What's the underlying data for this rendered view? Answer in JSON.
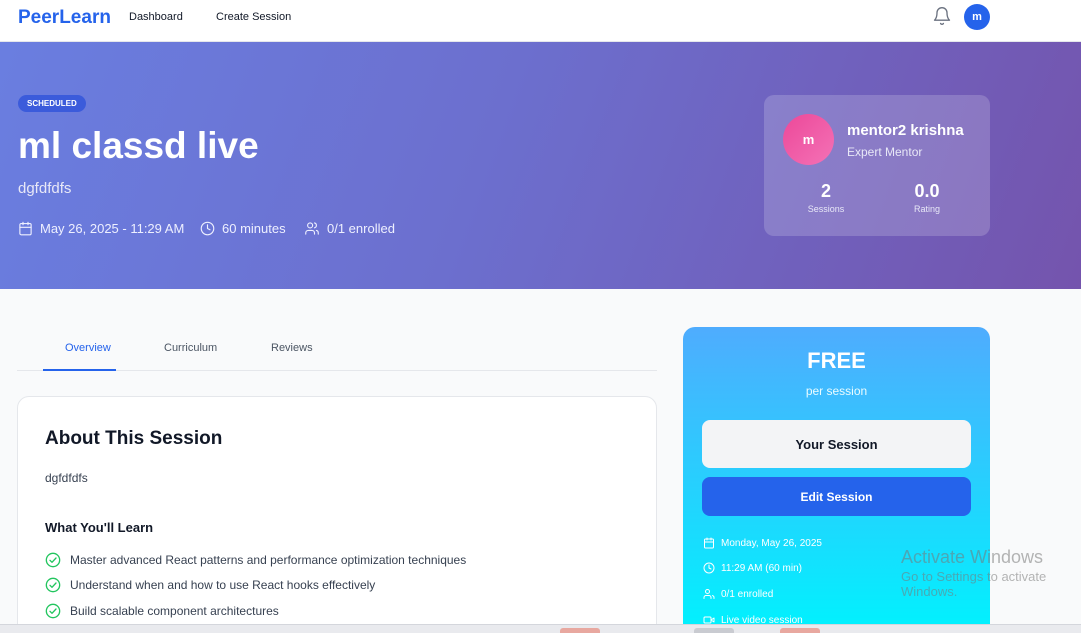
{
  "nav": {
    "brand": "PeerLearn",
    "links": [
      "Dashboard",
      "Create Session"
    ],
    "avatar_initial": "m"
  },
  "session": {
    "status_badge": "SCHEDULED",
    "title": "ml classd live",
    "subtitle": "dgfdfdfs",
    "date_time": "May 26, 2025 - 11:29 AM",
    "duration": "60 minutes",
    "enrolled": "0/1 enrolled"
  },
  "mentor": {
    "avatar_initial": "m",
    "name": "mentor2 krishna",
    "role": "Expert Mentor",
    "stats": [
      {
        "value": "2",
        "label": "Sessions"
      },
      {
        "value": "0.0",
        "label": "Rating"
      }
    ]
  },
  "tabs": [
    "Overview",
    "Curriculum",
    "Reviews"
  ],
  "about": {
    "title": "About This Session",
    "description": "dgfdfdfs",
    "learn_title": "What You'll Learn",
    "learn_items": [
      "Master advanced React patterns and performance optimization techniques",
      "Understand when and how to use React hooks effectively",
      "Build scalable component architectures"
    ]
  },
  "pricing": {
    "price": "FREE",
    "per": "per session",
    "primary_button": "Your Session",
    "secondary_button": "Edit Session",
    "details": [
      {
        "icon": "calendar-icon",
        "text": "Monday, May 26, 2025"
      },
      {
        "icon": "clock-icon",
        "text": "11:29 AM (60 min)"
      },
      {
        "icon": "users-icon",
        "text": "0/1 enrolled"
      },
      {
        "icon": "video-icon",
        "text": "Live video session"
      }
    ]
  },
  "watermark": {
    "line1": "Activate Windows",
    "line2": "Go to Settings to activate Windows."
  },
  "colors": {
    "brand": "#2563eb",
    "hero_start": "#6a7ee0",
    "hero_end": "#7454ad",
    "price_start": "#4facfe",
    "price_end": "#00f2fe",
    "check_green": "#22c55e"
  }
}
